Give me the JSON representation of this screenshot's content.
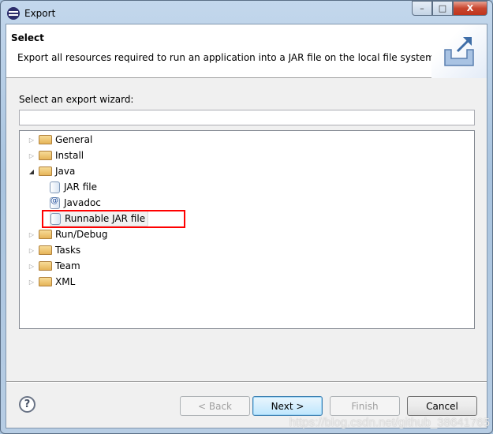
{
  "window": {
    "title": "Export",
    "icon": "eclipse-icon",
    "minimize": "–",
    "maximize": "□",
    "close": "X"
  },
  "header": {
    "title": "Select",
    "description": "Export all resources required to run an application into a JAR file on the local file system.",
    "icon": "export-icon"
  },
  "wizard_label": "Select an export wizard:",
  "filter": {
    "value": "",
    "placeholder": ""
  },
  "tree": [
    {
      "label": "General",
      "type": "folder",
      "expanded": false,
      "level": 0
    },
    {
      "label": "Install",
      "type": "folder",
      "expanded": false,
      "level": 0
    },
    {
      "label": "Java",
      "type": "folder",
      "expanded": true,
      "level": 0
    },
    {
      "label": "JAR file",
      "type": "jar",
      "level": 1
    },
    {
      "label": "Javadoc",
      "type": "javadoc",
      "level": 1
    },
    {
      "label": "Runnable JAR file",
      "type": "runnable-jar",
      "level": 1,
      "selected": true,
      "highlighted": true
    },
    {
      "label": "Run/Debug",
      "type": "folder",
      "expanded": false,
      "level": 0
    },
    {
      "label": "Tasks",
      "type": "folder",
      "expanded": false,
      "level": 0
    },
    {
      "label": "Team",
      "type": "folder",
      "expanded": false,
      "level": 0
    },
    {
      "label": "XML",
      "type": "folder",
      "expanded": false,
      "level": 0
    }
  ],
  "buttons": {
    "help": "?",
    "back": "< Back",
    "next": "Next >",
    "finish": "Finish",
    "cancel": "Cancel"
  },
  "watermark": "https://blog.csdn.net/github_38641765",
  "colors": {
    "highlight_box": "#ff0000",
    "default_button": "#3c7fb1"
  }
}
